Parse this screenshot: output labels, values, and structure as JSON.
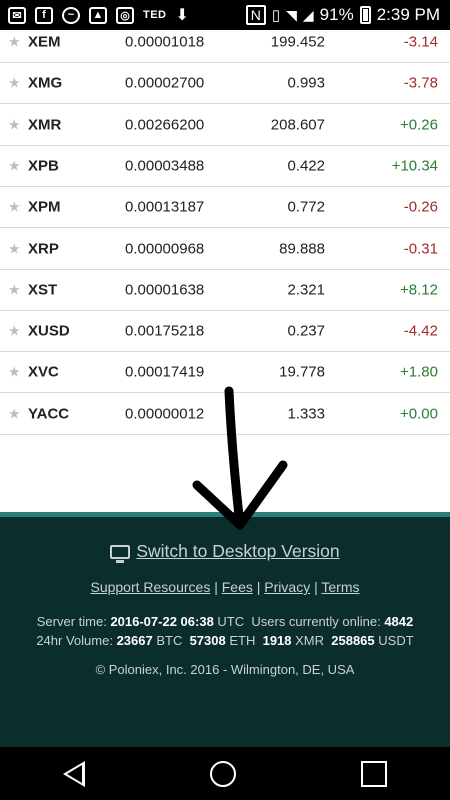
{
  "status_bar": {
    "icons": [
      "mail-icon",
      "facebook-icon",
      "messenger-icon",
      "gallery-icon",
      "instagram-icon",
      "ted-icon",
      "download-icon",
      "nfc-icon",
      "vibrate-icon",
      "wifi-icon",
      "signal-icon",
      "battery-icon"
    ],
    "ted_label": "TED",
    "battery": "91%",
    "time": "2:39 PM"
  },
  "table": {
    "rows": [
      {
        "symbol": "XEM",
        "price": "0.00001018",
        "volume": "199.452",
        "change": "-3.14"
      },
      {
        "symbol": "XMG",
        "price": "0.00002700",
        "volume": "0.993",
        "change": "-3.78"
      },
      {
        "symbol": "XMR",
        "price": "0.00266200",
        "volume": "208.607",
        "change": "+0.26"
      },
      {
        "symbol": "XPB",
        "price": "0.00003488",
        "volume": "0.422",
        "change": "+10.34"
      },
      {
        "symbol": "XPM",
        "price": "0.00013187",
        "volume": "0.772",
        "change": "-0.26"
      },
      {
        "symbol": "XRP",
        "price": "0.00000968",
        "volume": "89.888",
        "change": "-0.31"
      },
      {
        "symbol": "XST",
        "price": "0.00001638",
        "volume": "2.321",
        "change": "+8.12"
      },
      {
        "symbol": "XUSD",
        "price": "0.00175218",
        "volume": "0.237",
        "change": "-4.42"
      },
      {
        "symbol": "XVC",
        "price": "0.00017419",
        "volume": "19.778",
        "change": "+1.80"
      },
      {
        "symbol": "YACC",
        "price": "0.00000012",
        "volume": "1.333",
        "change": "+0.00"
      }
    ]
  },
  "footer": {
    "switch_label": "Switch to Desktop Version",
    "links": [
      "Support Resources",
      "Fees",
      "Privacy",
      "Terms"
    ],
    "server_time_label": "Server time:",
    "server_time_value": "2016-07-22 06:38",
    "server_time_tz": "UTC",
    "users_label": "Users currently online:",
    "users_value": "4842",
    "volume_label": "24hr Volume:",
    "volume_btc": "23667",
    "btc": "BTC",
    "volume_eth": "57308",
    "eth": "ETH",
    "volume_xmr": "1918",
    "xmr": "XMR",
    "volume_usdt": "258865",
    "usdt": "USDT",
    "copyright": "© Poloniex, Inc. 2016 - Wilmington, DE, USA"
  },
  "colors": {
    "negative": "#a52a2a",
    "positive": "#2e7d32",
    "footer_bg": "#0b2d2b",
    "footer_accent": "#2a7f76"
  }
}
